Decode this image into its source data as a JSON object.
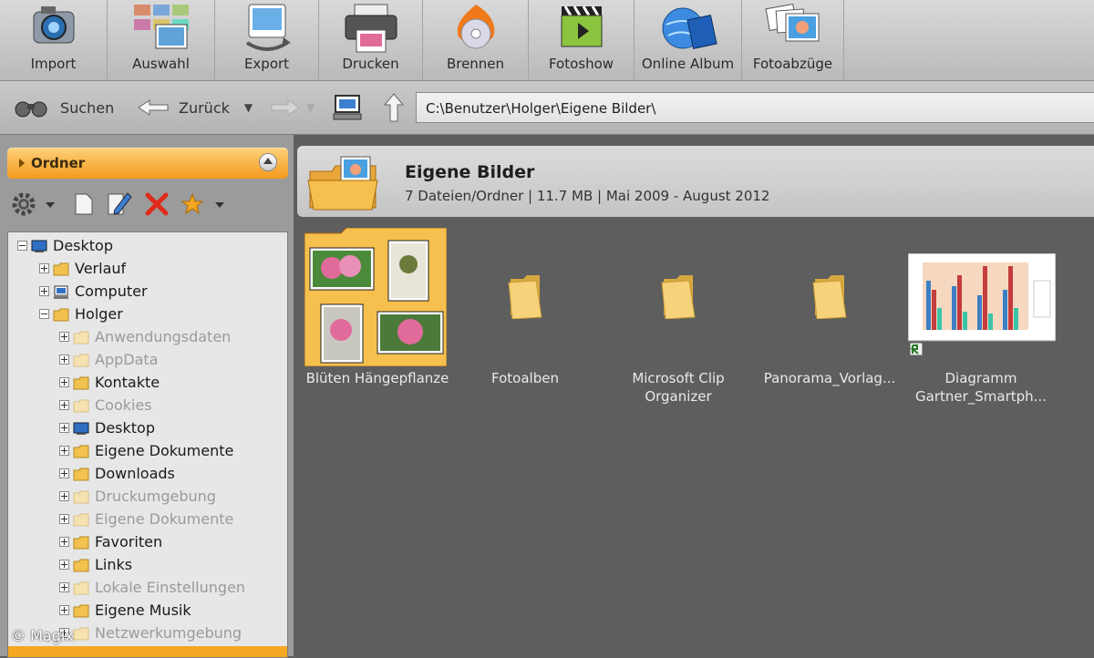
{
  "toolbar": {
    "items": [
      {
        "label": "Import",
        "icon": "camera-icon"
      },
      {
        "label": "Auswahl",
        "icon": "photo-grid-icon"
      },
      {
        "label": "Export",
        "icon": "export-photo-icon"
      },
      {
        "label": "Drucken",
        "icon": "printer-icon"
      },
      {
        "label": "Brennen",
        "icon": "disc-burn-icon"
      },
      {
        "label": "Fotoshow",
        "icon": "clapper-icon"
      },
      {
        "label": "Online Album",
        "icon": "globe-book-icon"
      },
      {
        "label": "Fotoabzüge",
        "icon": "photo-prints-icon"
      }
    ]
  },
  "navbar": {
    "search_label": "Suchen",
    "back_label": "Zurück",
    "path": "C:\\Benutzer\\Holger\\Eigene Bilder\\"
  },
  "leftpanel": {
    "header_label": "Ordner",
    "tree": [
      {
        "label": "Desktop",
        "dim": false
      },
      {
        "label": "Verlauf",
        "dim": false
      },
      {
        "label": "Computer",
        "dim": false
      },
      {
        "label": "Holger",
        "dim": false
      },
      {
        "label": "Anwendungsdaten",
        "dim": true
      },
      {
        "label": "AppData",
        "dim": true
      },
      {
        "label": "Kontakte",
        "dim": false
      },
      {
        "label": "Cookies",
        "dim": true
      },
      {
        "label": "Desktop",
        "dim": false
      },
      {
        "label": "Eigene Dokumente",
        "dim": false
      },
      {
        "label": "Downloads",
        "dim": false
      },
      {
        "label": "Druckumgebung",
        "dim": true
      },
      {
        "label": "Eigene Dokumente",
        "dim": true
      },
      {
        "label": "Favoriten",
        "dim": false
      },
      {
        "label": "Links",
        "dim": false
      },
      {
        "label": "Lokale Einstellungen",
        "dim": true
      },
      {
        "label": "Eigene Musik",
        "dim": false
      },
      {
        "label": "Netzwerkumgebung",
        "dim": true
      }
    ]
  },
  "content": {
    "title": "Eigene Bilder",
    "info": "7 Dateien/Ordner | 11.7 MB | Mai 2009 - August 2012",
    "items": [
      {
        "caption": "Blüten Hängepflanze"
      },
      {
        "caption": "Fotoalben"
      },
      {
        "caption": "Microsoft Clip Organizer"
      },
      {
        "caption": "Panorama_Vorlag..."
      },
      {
        "caption": "Diagramm Gartner_Smartph..."
      }
    ]
  },
  "copyright": "© Magix",
  "colors": {
    "accent": "#f5a623",
    "folder": "#f2c14e",
    "toolbar": "#c8c8c8"
  }
}
